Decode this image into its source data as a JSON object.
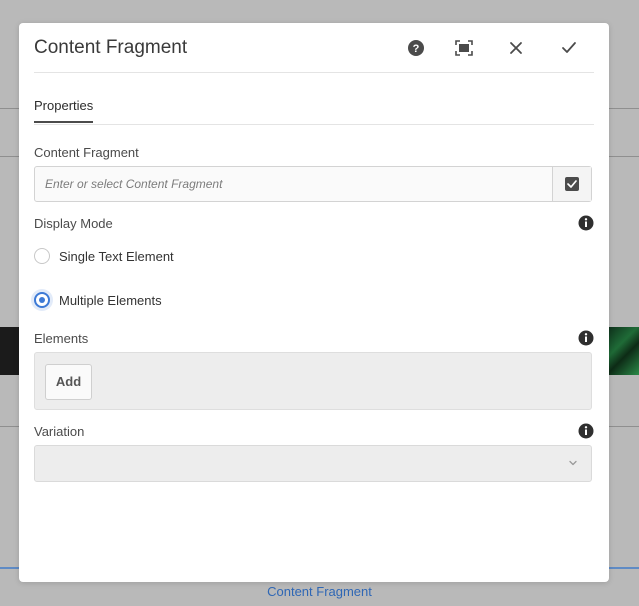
{
  "dialog": {
    "title": "Content Fragment",
    "header_buttons": [
      {
        "name": "help-icon"
      },
      {
        "name": "fullscreen-icon"
      },
      {
        "name": "close-icon"
      },
      {
        "name": "checkmark-icon"
      }
    ]
  },
  "tabs": [
    {
      "label": "Properties",
      "selected": true
    }
  ],
  "fields": {
    "content_fragment": {
      "label": "Content Fragment",
      "placeholder": "Enter or select Content Fragment",
      "value": "",
      "picker_icon": "check-square-icon"
    },
    "display_mode": {
      "label": "Display Mode",
      "options": [
        {
          "label": "Single Text Element",
          "checked": false
        },
        {
          "label": "Multiple Elements",
          "checked": true
        }
      ]
    },
    "elements": {
      "label": "Elements",
      "add_label": "Add"
    },
    "variation": {
      "label": "Variation",
      "value": ""
    }
  },
  "background": {
    "bottom_label": "Content Fragment"
  },
  "colors": {
    "accent": "#3d7ad6",
    "overlay": "#b9b9b9",
    "link": "#2f67b5"
  }
}
